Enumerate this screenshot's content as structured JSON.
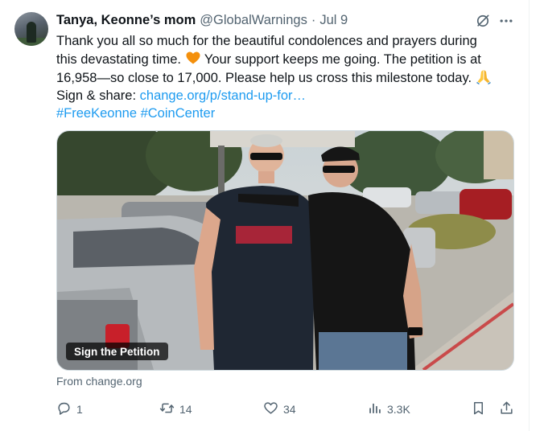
{
  "tweet": {
    "author_name": "Tanya, Keonne’s mom",
    "handle": "@GlobalWarnings",
    "separator": "·",
    "date": "Jul 9",
    "text_lines": [
      "Thank you all so much for the beautiful condolences and prayers during",
      "this devastating time.",
      "Your support keeps me going. The petition is at",
      "16,958—so close to 17,000. Please help us cross this milestone today.",
      "Sign & share:"
    ],
    "link_text": "change.org/p/stand-up-for…",
    "hashtags": [
      "#FreeKeonne",
      "#CoinCenter"
    ],
    "media_badge": "Sign the Petition",
    "source": "From change.org"
  },
  "actions": {
    "reply_count": "1",
    "repost_count": "14",
    "like_count": "34",
    "views_count": "3.3K"
  },
  "icons": {
    "grok": "grok-icon",
    "more": "more-icon",
    "reply": "reply-icon",
    "repost": "repost-icon",
    "like": "heart-icon",
    "views": "views-icon",
    "bookmark": "bookmark-icon",
    "share": "share-icon",
    "orange_heart": "orange-heart-emoji",
    "praying_hands": "praying-hands-emoji"
  },
  "colors": {
    "text": "#0f1419",
    "secondary": "#536471",
    "link": "#1d9bf0"
  }
}
